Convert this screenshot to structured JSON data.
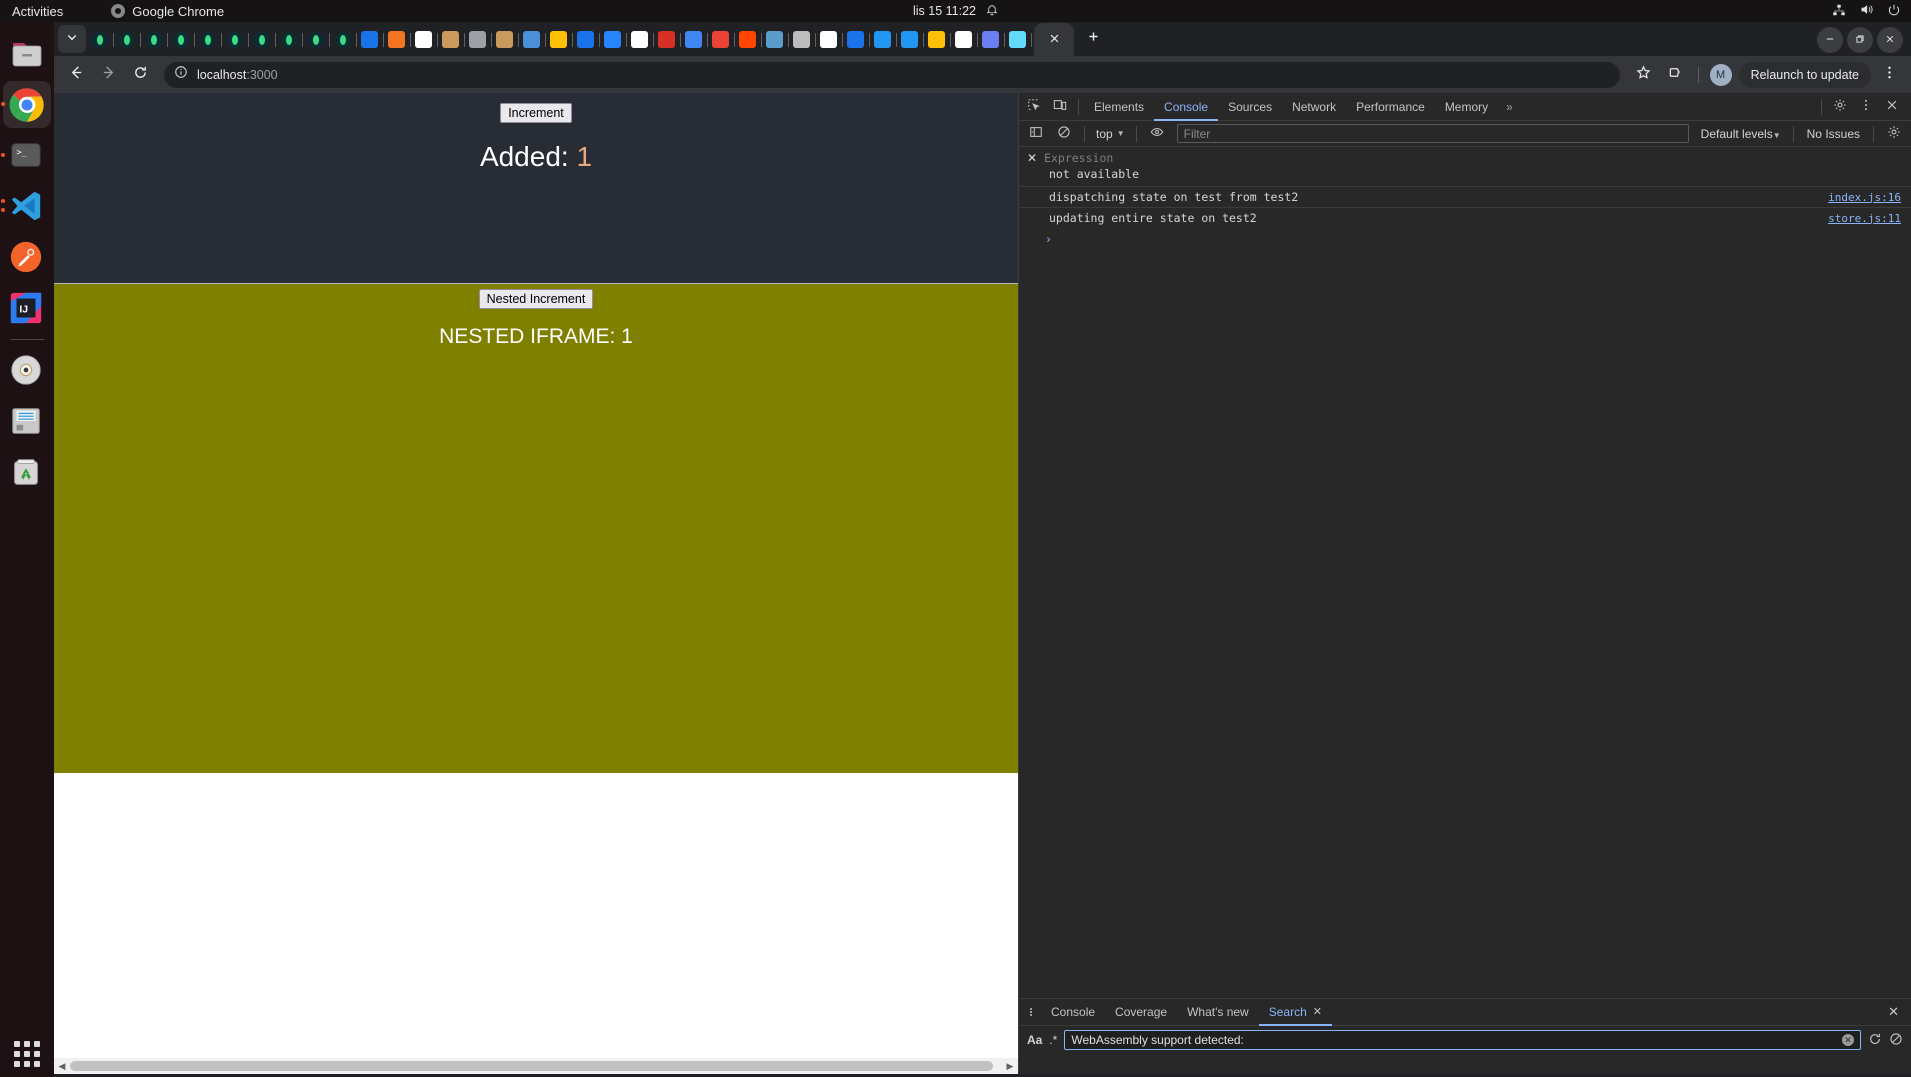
{
  "topbar": {
    "activities": "Activities",
    "app_name": "Google Chrome",
    "clock": "lis 15  11:22",
    "bell_icon": "bell-icon",
    "network_icon": "network-icon",
    "volume_icon": "volume-icon",
    "power_icon": "power-icon"
  },
  "dock": {
    "items": [
      {
        "name": "files",
        "icon": "folder-icon",
        "running": false,
        "active": false
      },
      {
        "name": "google-chrome",
        "icon": "chrome-icon",
        "running": true,
        "active": true
      },
      {
        "name": "terminal",
        "icon": "terminal-icon",
        "running": true,
        "active": false
      },
      {
        "name": "vs-code",
        "icon": "vscode-icon",
        "running": true,
        "active": false
      },
      {
        "name": "postman",
        "icon": "postman-icon",
        "running": false,
        "active": false
      },
      {
        "name": "intellij-idea",
        "icon": "intellij-icon",
        "running": false,
        "active": false
      },
      {
        "name": "disk-image",
        "icon": "cd-icon",
        "running": false,
        "active": false
      },
      {
        "name": "floppy-drive",
        "icon": "floppy-icon",
        "running": false,
        "active": false
      },
      {
        "name": "trash",
        "icon": "trash-icon",
        "running": false,
        "active": false
      }
    ],
    "show_apps": "show-applications-icon"
  },
  "chrome": {
    "tab_search_icon": "chevron-down-icon",
    "new_tab_icon": "plus-icon",
    "active_tab_close_icon": "close-icon",
    "window_controls": [
      {
        "name": "minimize",
        "icon": "minimize-icon"
      },
      {
        "name": "maximize",
        "icon": "restore-icon"
      },
      {
        "name": "close",
        "icon": "close-icon"
      }
    ],
    "tabs": [
      {
        "favicon": "leaf-icon",
        "color": "#3ddc84"
      },
      {
        "favicon": "leaf-icon",
        "color": "#3ddc84"
      },
      {
        "favicon": "leaf-icon",
        "color": "#3ddc84"
      },
      {
        "favicon": "leaf-icon",
        "color": "#3ddc84"
      },
      {
        "favicon": "leaf-icon",
        "color": "#3ddc84"
      },
      {
        "favicon": "leaf-icon",
        "color": "#3ddc84"
      },
      {
        "favicon": "leaf-icon",
        "color": "#3ddc84"
      },
      {
        "favicon": "leaf-icon",
        "color": "#3ddc84"
      },
      {
        "favicon": "leaf-icon",
        "color": "#3ddc84"
      },
      {
        "favicon": "leaf-icon",
        "color": "#3ddc84"
      },
      {
        "favicon": "puzzle-icon",
        "color": "#1a73e8"
      },
      {
        "favicon": "crunchyroll-icon",
        "color": "#f47521"
      },
      {
        "favicon": "animal-crossing-icon",
        "color": "#ffffff"
      },
      {
        "favicon": "tanuki-icon",
        "color": "#c99a5b"
      },
      {
        "favicon": "globe-icon",
        "color": "#9aa0a6"
      },
      {
        "favicon": "tanuki-icon",
        "color": "#c99a5b"
      },
      {
        "favicon": "kanji-icon",
        "color": "#4a90d9"
      },
      {
        "favicon": "google-drive-icon",
        "color": "#ffc107"
      },
      {
        "favicon": "birds-icon",
        "color": "#1a73e8"
      },
      {
        "favicon": "atlassian-icon",
        "color": "#2684ff"
      },
      {
        "favicon": "github-icon",
        "color": "#ffffff"
      },
      {
        "favicon": "chrome-store-icon",
        "color": "#d93025"
      },
      {
        "favicon": "google-icon",
        "color": "#4285f4"
      },
      {
        "favicon": "gmail-icon",
        "color": "#ea4335"
      },
      {
        "favicon": "reddit-icon",
        "color": "#ff4500"
      },
      {
        "favicon": "matrix-icon",
        "color": "#5c9ccc"
      },
      {
        "favicon": "planet-icon",
        "color": "#bdbdbd"
      },
      {
        "favicon": "bone-icon",
        "color": "#ffffff"
      },
      {
        "favicon": "circle-arrow-icon",
        "color": "#1a73e8"
      },
      {
        "favicon": "water-drop-icon",
        "color": "#2196f3"
      },
      {
        "favicon": "water-drop-icon",
        "color": "#2196f3"
      },
      {
        "favicon": "google-drive-icon",
        "color": "#ffc107"
      },
      {
        "favicon": "bone-icon",
        "color": "#ffffff"
      },
      {
        "favicon": "api-icon",
        "color": "#6a7ef0"
      },
      {
        "favicon": "react-icon",
        "color": "#61dafb"
      }
    ],
    "toolbar": {
      "back_icon": "arrow-left-icon",
      "forward_icon": "arrow-right-icon",
      "reload_icon": "reload-icon",
      "site_info_icon": "info-circle-icon",
      "url_host": "localhost",
      "url_port": ":3000",
      "bookmark_icon": "star-icon",
      "extensions_icon": "extensions-icon",
      "profile_initial": "M",
      "relaunch_label": "Relaunch to update",
      "menu_icon": "three-dots-vertical-icon"
    }
  },
  "page": {
    "increment_button": "Increment",
    "added_label": "Added:",
    "added_value": "1",
    "nested_increment_button": "Nested Increment",
    "nested_label": "NESTED IFRAME:",
    "nested_value": "1",
    "iframe_bg": "#808000",
    "outer_bg": "#282c34",
    "scroll_left_icon": "chevron-left-icon",
    "scroll_right_icon": "chevron-right-icon"
  },
  "devtools": {
    "inspect_icon": "inspect-element-icon",
    "device_icon": "device-toolbar-icon",
    "tabs": [
      {
        "label": "Elements",
        "selected": false
      },
      {
        "label": "Console",
        "selected": true
      },
      {
        "label": "Sources",
        "selected": false
      },
      {
        "label": "Network",
        "selected": false
      },
      {
        "label": "Performance",
        "selected": false
      },
      {
        "label": "Memory",
        "selected": false
      }
    ],
    "more_tabs": "»",
    "settings_icon": "gear-icon",
    "dots_icon": "three-dots-vertical-icon",
    "close_icon": "close-icon",
    "console_toolbar": {
      "sidebar_icon": "console-sidebar-icon",
      "clear_icon": "clear-console-icon",
      "context": "top",
      "eye_icon": "live-expression-icon",
      "filter_placeholder": "Filter",
      "levels_label": "Default levels",
      "issues_label": "No Issues",
      "settings_icon": "gear-icon"
    },
    "live_expression": {
      "close_icon": "close-icon",
      "placeholder": "Expression",
      "value": "not available"
    },
    "messages": [
      {
        "text": "dispatching state on test from test2",
        "source": "index.js:16"
      },
      {
        "text": "updating entire state on test2",
        "source": "store.js:11"
      }
    ],
    "prompt_icon": "›",
    "drawer": {
      "menu_icon": "three-dots-vertical-icon",
      "tabs": [
        {
          "label": "Console",
          "selected": false,
          "closable": false
        },
        {
          "label": "Coverage",
          "selected": false,
          "closable": false
        },
        {
          "label": "What's new",
          "selected": false,
          "closable": false
        },
        {
          "label": "Search",
          "selected": true,
          "closable": true
        }
      ],
      "close_icon": "close-icon",
      "search": {
        "match_case_icon": "Aa",
        "regex_icon": ".*",
        "query": "WebAssembly support detected:",
        "clear_icon": "clear-input-icon",
        "refresh_icon": "refresh-icon",
        "clear_results_icon": "clear-results-icon"
      }
    }
  }
}
